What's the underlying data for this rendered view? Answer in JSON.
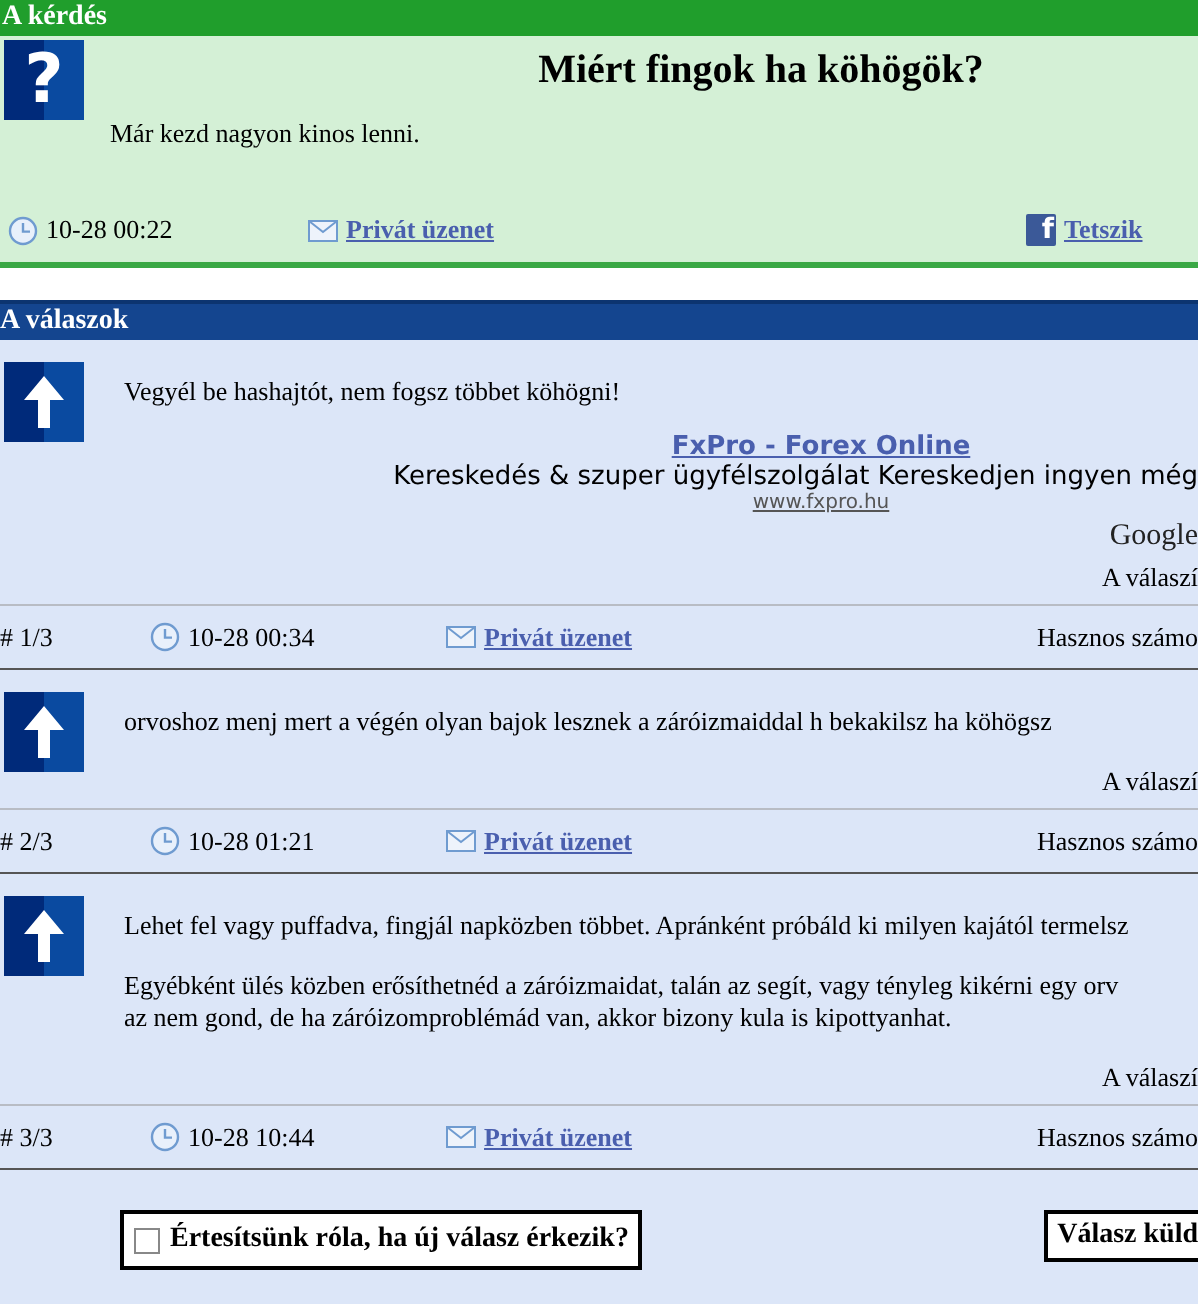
{
  "question": {
    "header": "A kérdés",
    "avatar_symbol": "?",
    "title": "Miért fingok ha köhögök?",
    "body": "Már kezd nagyon kinos lenni.",
    "time": "10-28 00:22",
    "pm_link": "Privát üzenet",
    "like_symbol": "f",
    "like_link": "Tetszik"
  },
  "answers_header": "A válaszok",
  "answers": [
    {
      "paragraphs": [
        "Vegyél be hashajtót, nem fogsz többet köhögni!"
      ],
      "ad": {
        "title": "FxPro - Forex Online",
        "text": "Kereskedés & szuper ügyfélszolgálat Kereskedjen ingyen még",
        "url": "www.fxpro.hu",
        "provider": "Google"
      },
      "rate_text": "A válaszí",
      "index": "# 1/3",
      "time": "10-28 00:34",
      "pm_link": "Privát üzenet",
      "useful": "Hasznos számo"
    },
    {
      "paragraphs": [
        "orvoshoz menj mert a végén olyan bajok lesznek a záróizmaiddal h bekakilsz ha köhögsz"
      ],
      "rate_text": "A válaszí",
      "index": "# 2/3",
      "time": "10-28 01:21",
      "pm_link": "Privát üzenet",
      "useful": "Hasznos számo"
    },
    {
      "paragraphs": [
        "Lehet fel vagy puffadva, fingjál napközben többet. Apránként próbáld ki milyen kajától termelsz",
        "Egyébként ülés közben erősíthetnéd a záróizmaidat, talán az segít, vagy tényleg kikérni egy orv\naz nem gond, de ha záróizomproblémád van, akkor bizony kula is kipottyanhat."
      ],
      "rate_text": "A válaszí",
      "index": "# 3/3",
      "time": "10-28 10:44",
      "pm_link": "Privát üzenet",
      "useful": "Hasznos számo"
    }
  ],
  "notify": {
    "label": "Értesítsünk róla, ha új válasz érkezik?",
    "checked": false
  },
  "send_button": "Válasz küld"
}
